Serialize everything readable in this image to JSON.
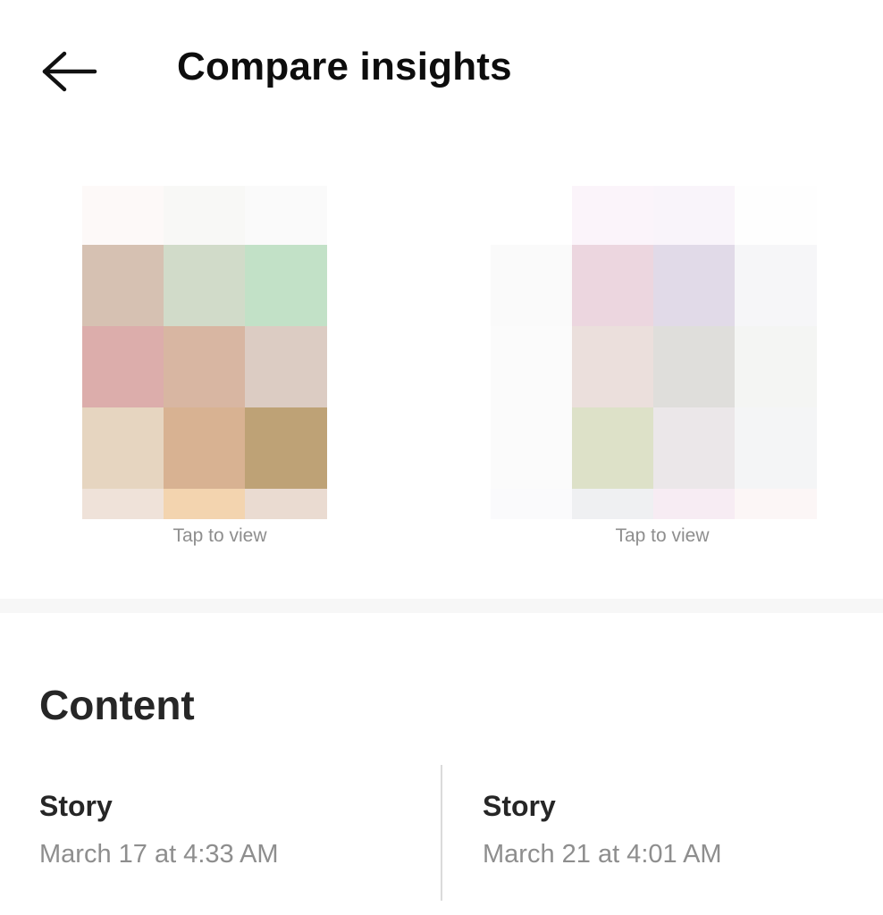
{
  "header": {
    "title": "Compare insights",
    "back_icon": "arrow-left-icon"
  },
  "previews": [
    {
      "tap_label": "Tap to view",
      "colors": [
        [
          "#fdf9f8",
          "#f8f8f6",
          "#fafafa"
        ],
        [
          "#d6c1b2",
          "#d1dbc9",
          "#c2e1c7"
        ],
        [
          "#dcadab",
          "#d8b6a2",
          "#dcccc3"
        ],
        [
          "#e6d5c0",
          "#d8b292",
          "#bea276"
        ],
        [
          "#efe2d9",
          "#f3d4af",
          "#eadbd1"
        ]
      ]
    },
    {
      "tap_label": "Tap to view",
      "colors": [
        [
          "#ffffff",
          "#fbf4fa",
          "#f9f4fa",
          "#fefefe"
        ],
        [
          "#fafafa",
          "#ecd6df",
          "#e1dae8",
          "#f6f6f8"
        ],
        [
          "#fbfbfb",
          "#ebdfdc",
          "#dfdedb",
          "#f4f5f3"
        ],
        [
          "#fbfbfb",
          "#dde1c8",
          "#ebe7e9",
          "#f4f5f6"
        ],
        [
          "#fafafc",
          "#eff0f2",
          "#f7ecf3",
          "#fcf6f6"
        ]
      ]
    }
  ],
  "content": {
    "section_title": "Content",
    "left": {
      "type_label": "Story",
      "timestamp": "March 17 at 4:33 AM"
    },
    "right": {
      "type_label": "Story",
      "timestamp": "March 21 at 4:01 AM"
    }
  }
}
